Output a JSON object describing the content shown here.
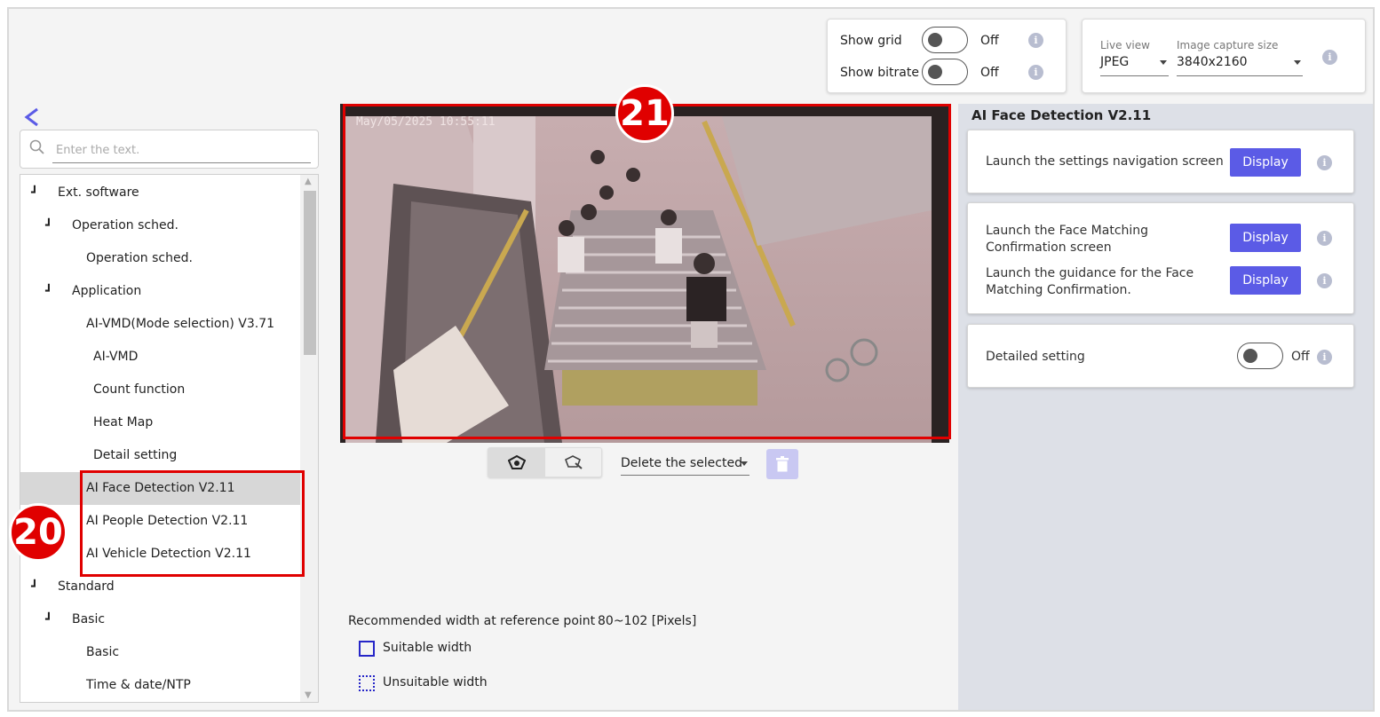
{
  "topbar": {
    "show_grid": {
      "label": "Show grid",
      "state": "Off"
    },
    "show_bitrate": {
      "label": "Show bitrate",
      "state": "Off"
    },
    "live_view": {
      "label": "Live view",
      "value": "JPEG"
    },
    "capture_size": {
      "label": "Image capture size",
      "value": "3840x2160"
    }
  },
  "search": {
    "placeholder": "Enter the text."
  },
  "tree": {
    "items": [
      {
        "label": "Ext. software",
        "expander": true
      },
      {
        "label": "Operation sched.",
        "expander": true
      },
      {
        "label": "Operation sched.",
        "expander": false
      },
      {
        "label": "Application",
        "expander": true
      },
      {
        "label": "AI-VMD(Mode selection) V3.71",
        "expander": false
      },
      {
        "label": "AI-VMD",
        "expander": false
      },
      {
        "label": "Count function",
        "expander": false
      },
      {
        "label": "Heat Map",
        "expander": false
      },
      {
        "label": "Detail setting",
        "expander": false
      },
      {
        "label": "AI Face Detection V2.11",
        "expander": false,
        "selected": true
      },
      {
        "label": "AI People Detection V2.11",
        "expander": false
      },
      {
        "label": "AI Vehicle Detection V2.11",
        "expander": false
      },
      {
        "label": "Standard",
        "expander": true
      },
      {
        "label": "Basic",
        "expander": true
      },
      {
        "label": "Basic",
        "expander": false
      },
      {
        "label": "Time & date/NTP",
        "expander": false
      }
    ]
  },
  "video": {
    "timestamp": "May/05/2025 10:55:11"
  },
  "center": {
    "delete_selected": "Delete the selected",
    "recommended_label": "Recommended width at reference point",
    "recommended_value": "80~102 [Pixels]",
    "suitable": "Suitable width",
    "unsuitable": "Unsuitable width"
  },
  "right": {
    "title": "AI Face Detection V2.11",
    "launch_settings": "Launch the settings navigation screen",
    "launch_face_matching": "Launch the Face Matching Confirmation screen",
    "launch_guidance": "Launch the guidance for the Face Matching Confirmation.",
    "display_label": "Display",
    "detailed_setting": "Detailed setting",
    "detailed_state": "Off"
  },
  "annotations": {
    "badge_20": "20",
    "badge_21": "21"
  },
  "colors": {
    "accent": "#5b5be6",
    "annotation": "#e00000",
    "right_panel_bg": "#dde0e7"
  }
}
